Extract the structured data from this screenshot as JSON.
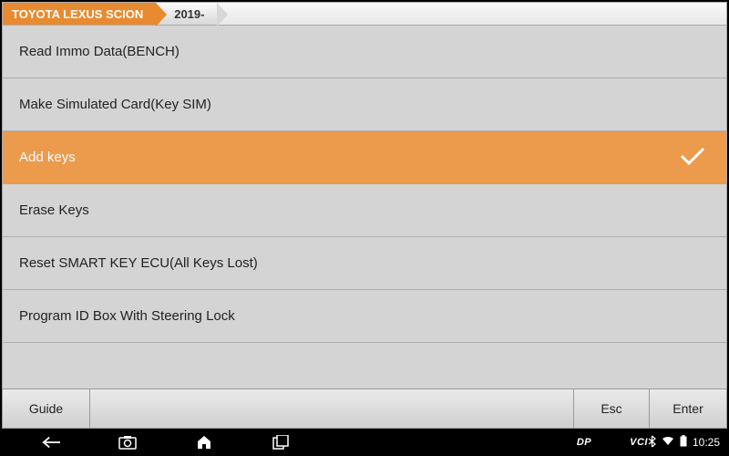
{
  "breadcrumb": {
    "segments": [
      {
        "label": "TOYOTA LEXUS SCION",
        "active": true
      },
      {
        "label": "2019-",
        "active": false
      }
    ]
  },
  "menu": {
    "items": [
      {
        "label": "Read Immo Data(BENCH)",
        "selected": false
      },
      {
        "label": "Make Simulated Card(Key SIM)",
        "selected": false
      },
      {
        "label": "Add keys",
        "selected": true
      },
      {
        "label": "Erase Keys",
        "selected": false
      },
      {
        "label": "Reset SMART KEY ECU(All Keys Lost)",
        "selected": false
      },
      {
        "label": "Program ID Box With Steering Lock",
        "selected": false
      }
    ]
  },
  "buttons": {
    "guide": "Guide",
    "esc": "Esc",
    "enter": "Enter"
  },
  "navbar": {
    "dp": "DP",
    "vci": "VCI",
    "time": "10:25"
  }
}
